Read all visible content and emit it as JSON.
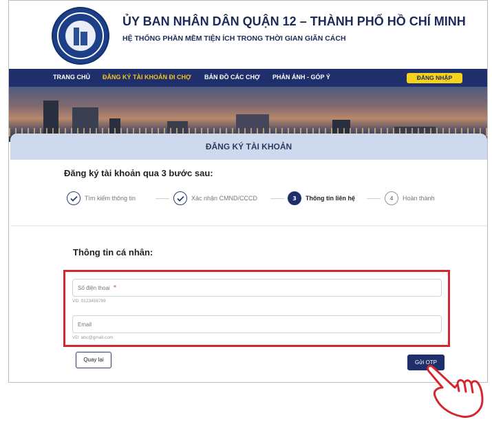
{
  "header": {
    "title": "ỦY BAN NHÂN DÂN QUẬN 12 – THÀNH PHỐ HỒ CHÍ MINH",
    "subtitle": "HỆ THỐNG PHẦN MỀM TIỆN ÍCH TRONG THỜI GIAN GIÃN CÁCH",
    "logo_icon": "district-12-emblem-logo"
  },
  "nav": {
    "items": [
      {
        "label": "TRANG CHỦ",
        "active": false
      },
      {
        "label": "ĐĂNG KÝ TÀI KHOẢN ĐI CHỢ",
        "active": true
      },
      {
        "label": "BẢN ĐỒ CÁC CHỢ",
        "active": false
      },
      {
        "label": "PHẢN ÁNH - GÓP Ý",
        "active": false
      }
    ],
    "login_label": "ĐĂNG NHẬP"
  },
  "form": {
    "heading": "ĐĂNG KÝ TÀI KHOẢN",
    "steps_title": "Đăng ký tài khoản qua 3 bước sau:",
    "steps": [
      {
        "number": "",
        "label": "Tìm kiếm thông tin",
        "status": "done"
      },
      {
        "number": "",
        "label": "Xác nhận CMND/CCCD",
        "status": "done"
      },
      {
        "number": "3",
        "label": "Thông tin liên hệ",
        "status": "active"
      },
      {
        "number": "4",
        "label": "Hoàn thành",
        "status": "pending"
      }
    ],
    "section_title": "Thông tin cá nhân:",
    "phone": {
      "value": "",
      "placeholder": "Số điện thoại",
      "required_mark": "*",
      "hint": "VD: 0123456789"
    },
    "email": {
      "value": "",
      "placeholder": "Email",
      "hint": "VD: abc@gmail.com"
    },
    "back_label": "Quay lại",
    "otp_label": "Gửi OTP"
  },
  "colors": {
    "nav_bg": "#1f2f6b",
    "nav_active": "#f5c520",
    "login_bg": "#f7d21c",
    "card_header_bg": "#cfd9ee",
    "highlight": "#d4262f"
  }
}
